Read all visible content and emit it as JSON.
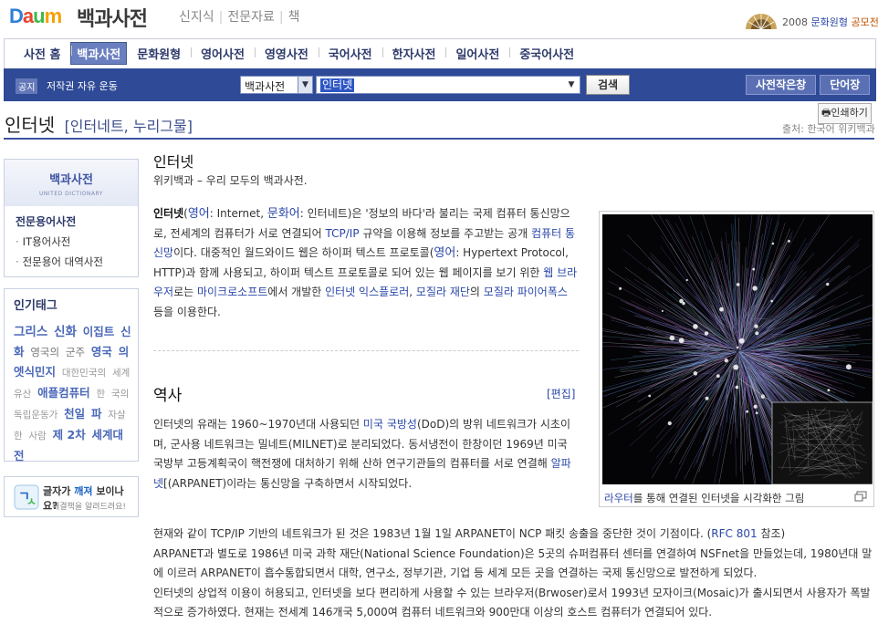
{
  "header": {
    "logo_text": "Daum",
    "logo_letters": [
      "D",
      "a",
      "u",
      "m"
    ],
    "service_title": "백과사전",
    "service_links": [
      "신지식",
      "전문자료",
      "책"
    ],
    "promo_year": "2008",
    "promo_highlight": "문화원형",
    "promo_link": "공모전"
  },
  "nav": {
    "items": [
      "사전 홈",
      "백과사전",
      "문화원형",
      "영어사전",
      "영영사전",
      "국어사전",
      "한자사전",
      "일어사전",
      "중국어사전"
    ],
    "active": "백과사전"
  },
  "search": {
    "notice_tag": "공지",
    "notice_text": "저작권 자유 운동",
    "scope_value": "백과사전",
    "query": "인터넷",
    "button_label": "검색",
    "right_buttons": [
      "사전작은창",
      "단어장"
    ]
  },
  "entry": {
    "title": "인터넷",
    "aliases": "[인터네트, 누리그물]",
    "print_label": "인쇄하기",
    "source": "출처: 한국어 위키백과"
  },
  "sidebar": {
    "dict_title": "백과사전",
    "dict_subtitle": "UNITED DICTIONARY",
    "spec_title": "전문용어사전",
    "spec_links": [
      "IT용어사전",
      "전문용어 대역사전"
    ],
    "tags_title": "인기태그",
    "tags": [
      {
        "text": "그리스",
        "size": 4
      },
      {
        "text": "신화",
        "size": 4
      },
      {
        "text": "이집트",
        "size": 3
      },
      {
        "text": "신화",
        "size": 3
      },
      {
        "text": "영국의",
        "size": 2
      },
      {
        "text": "군주",
        "size": 2
      },
      {
        "text": "영국",
        "size": 3
      },
      {
        "text": "의엣식민지",
        "size": 3
      },
      {
        "text": "대한민국의",
        "size": 1
      },
      {
        "text": "세계유산",
        "size": 1
      },
      {
        "text": "애플컴퓨터",
        "size": 3
      },
      {
        "text": "한",
        "size": 1
      },
      {
        "text": "국의",
        "size": 1
      },
      {
        "text": "독립운동가",
        "size": 1
      },
      {
        "text": "천일",
        "size": 3
      },
      {
        "text": "파",
        "size": 3
      },
      {
        "text": "자살한",
        "size": 1
      },
      {
        "text": "사람",
        "size": 1
      },
      {
        "text": "제 2차",
        "size": 3
      },
      {
        "text": "세계대전",
        "size": 3
      }
    ],
    "font_line1_a": "글자가",
    "font_line1_b": "깨져",
    "font_line1_c": "보이나요?",
    "font_line2": "해결책을 알려드려요!"
  },
  "article": {
    "title": "인터넷",
    "subtitle": "위키백과 – 우리 모두의 백과사전.",
    "p1": [
      {
        "t": "인터넷",
        "k": "b"
      },
      {
        "t": "(",
        "k": "t"
      },
      {
        "t": "영어",
        "k": "han"
      },
      {
        "t": ": Internet, ",
        "k": "t"
      },
      {
        "t": "문화어",
        "k": "han"
      },
      {
        "t": ": 인터네트)은 '정보의 바다'라 불리는 국제 컴퓨터 통신망으로, 전세계의 컴퓨터가 서로 연결되어 ",
        "k": "t"
      },
      {
        "t": "TCP/IP",
        "k": "link"
      },
      {
        "t": " 규약을 이용해 정보를 주고받는 공개 ",
        "k": "t"
      },
      {
        "t": "컴퓨터",
        "k": "link"
      },
      {
        "t": " ",
        "k": "t"
      },
      {
        "t": "통신망",
        "k": "link"
      },
      {
        "t": "이다. 대중적인 월드와이드 웹은 하이퍼 텍스트 프로토콜(",
        "k": "t"
      },
      {
        "t": "영어",
        "k": "han"
      },
      {
        "t": ": Hypertext Protocol, HTTP)과 함께 사용되고, 하이퍼 텍스트 프로토콜로 되어 있는 웹 페이지를 보기 위한 ",
        "k": "t"
      },
      {
        "t": "웹 브라우저",
        "k": "link"
      },
      {
        "t": "로는 ",
        "k": "t"
      },
      {
        "t": "마이크로소프트",
        "k": "link"
      },
      {
        "t": "에서 개발한 ",
        "k": "t"
      },
      {
        "t": "인터넷 익스플로러",
        "k": "link"
      },
      {
        "t": ", ",
        "k": "t"
      },
      {
        "t": "모질라 재단",
        "k": "link"
      },
      {
        "t": "의 ",
        "k": "t"
      },
      {
        "t": "모질라 파이어폭스",
        "k": "link"
      },
      {
        "t": " 등을 이용한다.",
        "k": "t"
      }
    ],
    "history_title": "역사",
    "edit_label": "[편집]",
    "p2": [
      {
        "t": "인터넷의 유래는 1960~1970년대 사용되던 ",
        "k": "t"
      },
      {
        "t": "미국 국방성",
        "k": "link"
      },
      {
        "t": "(DoD)의 방위 네트워크가 시초이며, 군사용 네트워크는 밀네트(MILNET)로 분리되었다. 동서냉전이 한창이던 1969년 미국 국방부 고등계획국이 핵전쟁에 대처하기 위해 산하 연구기관들의 컴퓨터를 서로 연결해 ",
        "k": "t"
      },
      {
        "t": "알파넷",
        "k": "link"
      },
      {
        "t": "[(ARPANET)이라는 통신망을 구축하면서 시작되었다.",
        "k": "t"
      }
    ],
    "p3a": [
      {
        "t": "현재와 같이 TCP/IP 기반의 네트워크가 된 것은 1983년 1월 1일 ARPANET이 NCP 패킷 송출을 중단한 것이 기점이다. (",
        "k": "t"
      },
      {
        "t": "RFC 801",
        "k": "link"
      },
      {
        "t": " 참조)",
        "k": "t"
      }
    ],
    "p3b": "ARPANET과 별도로 1986년 미국 과학 재단(National Science Foundation)은 5곳의 슈퍼컴퓨터 센터를 연결하여 NSFnet을 만들었는데, 1980년대 말에 이르러 ARPANET이 흡수통합되면서 대학, 연구소, 정부기관, 기업 등 세계 모든 곳을 연결하는 국제 통신망으로 발전하게 되었다.",
    "p3c": "인터넷의 상업적 이용이 허용되고, 인터넷을 보다 편리하게 사용할 수 있는 브라우저(Brwoser)로서 1993년 모자이크(Mosaic)가 출시되면서 사용자가 폭발적으로 증가하였다. 현재는 전세계 146개국 5,000여 컴퓨터 네트워크와 900만대 이상의 호스트 컴퓨터가 연결되어 있다.",
    "figure_caption_link": "라우터",
    "figure_caption_rest": "를 통해 연결된 인터넷을 시각화한 그림"
  },
  "colors": {
    "brand_blue": "#2f4a96",
    "link": "#2a47a8",
    "logo": [
      "#f5a000",
      "#3bbb4a",
      "#e8452c",
      "#2f7fd8"
    ]
  }
}
